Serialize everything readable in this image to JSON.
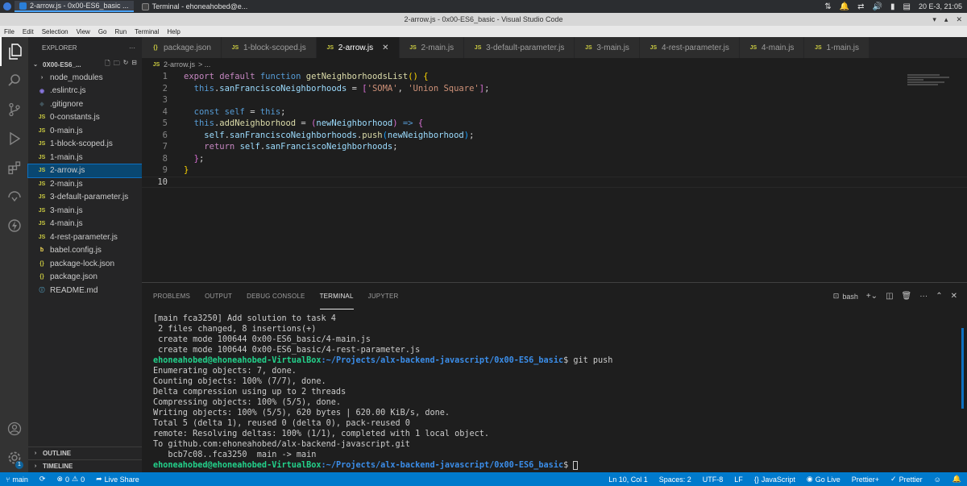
{
  "os": {
    "tasks": [
      {
        "label": "2-arrow.js - 0x00-ES6_basic ...",
        "active": true
      },
      {
        "label": "Terminal - ehoneahobed@e...",
        "active": false
      }
    ],
    "clock": "20 E-3, 21:05"
  },
  "window": {
    "title": "2-arrow.js - 0x00-ES6_basic - Visual Studio Code"
  },
  "menu": [
    "File",
    "Edit",
    "Selection",
    "View",
    "Go",
    "Run",
    "Terminal",
    "Help"
  ],
  "activity": {
    "accounts_badge": "1"
  },
  "sidebar": {
    "header": "EXPLORER",
    "more": "···",
    "folder": "0X00-ES6_...",
    "items": [
      {
        "label": "node_modules",
        "icon": "chevron-right-icon",
        "type": "folder"
      },
      {
        "label": ".eslintrc.js",
        "icon": "eslint-icon",
        "type": "eslint"
      },
      {
        "label": ".gitignore",
        "icon": "git-icon",
        "type": "git"
      },
      {
        "label": "0-constants.js",
        "icon": "js-icon",
        "type": "js"
      },
      {
        "label": "0-main.js",
        "icon": "js-icon",
        "type": "js"
      },
      {
        "label": "1-block-scoped.js",
        "icon": "js-icon",
        "type": "js"
      },
      {
        "label": "1-main.js",
        "icon": "js-icon",
        "type": "js"
      },
      {
        "label": "2-arrow.js",
        "icon": "js-icon",
        "type": "js",
        "selected": true
      },
      {
        "label": "2-main.js",
        "icon": "js-icon",
        "type": "js"
      },
      {
        "label": "3-default-parameter.js",
        "icon": "js-icon",
        "type": "js"
      },
      {
        "label": "3-main.js",
        "icon": "js-icon",
        "type": "js"
      },
      {
        "label": "4-main.js",
        "icon": "js-icon",
        "type": "js"
      },
      {
        "label": "4-rest-parameter.js",
        "icon": "js-icon",
        "type": "js"
      },
      {
        "label": "babel.config.js",
        "icon": "babel-icon",
        "type": "babel"
      },
      {
        "label": "package-lock.json",
        "icon": "json-icon",
        "type": "json"
      },
      {
        "label": "package.json",
        "icon": "json-icon",
        "type": "json"
      },
      {
        "label": "README.md",
        "icon": "info-icon",
        "type": "info"
      }
    ],
    "outline": "OUTLINE",
    "timeline": "TIMELINE"
  },
  "tabs": [
    {
      "label": "package.json",
      "icon": "{}",
      "type": "json"
    },
    {
      "label": "1-block-scoped.js",
      "icon": "JS",
      "type": "js"
    },
    {
      "label": "2-arrow.js",
      "icon": "JS",
      "type": "js",
      "active": true
    },
    {
      "label": "2-main.js",
      "icon": "JS",
      "type": "js"
    },
    {
      "label": "3-default-parameter.js",
      "icon": "JS",
      "type": "js"
    },
    {
      "label": "3-main.js",
      "icon": "JS",
      "type": "js"
    },
    {
      "label": "4-rest-parameter.js",
      "icon": "JS",
      "type": "js"
    },
    {
      "label": "4-main.js",
      "icon": "JS",
      "type": "js"
    },
    {
      "label": "1-main.js",
      "icon": "JS",
      "type": "js"
    }
  ],
  "breadcrumb": {
    "file_icon": "JS",
    "file": "2-arrow.js",
    "rest": "> ..."
  },
  "editor": {
    "current_line": 10,
    "lines": [
      [
        [
          "kw",
          "export"
        ],
        [
          "t",
          " "
        ],
        [
          "kw",
          "default"
        ],
        [
          "t",
          " "
        ],
        [
          "kwb",
          "function"
        ],
        [
          "t",
          " "
        ],
        [
          "fn",
          "getNeighborhoodsList"
        ],
        [
          "br1",
          "()"
        ],
        [
          "t",
          " "
        ],
        [
          "br1",
          "{"
        ]
      ],
      [
        [
          "t",
          "  "
        ],
        [
          "kwb",
          "this"
        ],
        [
          "t",
          "."
        ],
        [
          "var",
          "sanFranciscoNeighborhoods"
        ],
        [
          "t",
          " = "
        ],
        [
          "br2",
          "["
        ],
        [
          "str",
          "'SOMA'"
        ],
        [
          "t",
          ", "
        ],
        [
          "str",
          "'Union Square'"
        ],
        [
          "br2",
          "]"
        ],
        [
          "t",
          ";"
        ]
      ],
      [],
      [
        [
          "t",
          "  "
        ],
        [
          "kwb",
          "const"
        ],
        [
          "t",
          " "
        ],
        [
          "kwb",
          "self"
        ],
        [
          "t",
          " = "
        ],
        [
          "kwb",
          "this"
        ],
        [
          "t",
          ";"
        ]
      ],
      [
        [
          "t",
          "  "
        ],
        [
          "kwb",
          "this"
        ],
        [
          "t",
          "."
        ],
        [
          "fn",
          "addNeighborhood"
        ],
        [
          "t",
          " = "
        ],
        [
          "br2",
          "("
        ],
        [
          "var",
          "newNeighborhood"
        ],
        [
          "br2",
          ")"
        ],
        [
          "t",
          " "
        ],
        [
          "kwb",
          "=>"
        ],
        [
          "t",
          " "
        ],
        [
          "br2",
          "{"
        ]
      ],
      [
        [
          "t",
          "    "
        ],
        [
          "var",
          "self"
        ],
        [
          "t",
          "."
        ],
        [
          "var",
          "sanFranciscoNeighborhoods"
        ],
        [
          "t",
          "."
        ],
        [
          "fn",
          "push"
        ],
        [
          "br3",
          "("
        ],
        [
          "var",
          "newNeighborhood"
        ],
        [
          "br3",
          ")"
        ],
        [
          "t",
          ";"
        ]
      ],
      [
        [
          "t",
          "    "
        ],
        [
          "kw",
          "return"
        ],
        [
          "t",
          " "
        ],
        [
          "var",
          "self"
        ],
        [
          "t",
          "."
        ],
        [
          "var",
          "sanFranciscoNeighborhoods"
        ],
        [
          "t",
          ";"
        ]
      ],
      [
        [
          "t",
          "  "
        ],
        [
          "br2",
          "}"
        ],
        [
          "t",
          ";"
        ]
      ],
      [
        [
          "br1",
          "}"
        ]
      ],
      []
    ]
  },
  "panel": {
    "tabs": [
      "PROBLEMS",
      "OUTPUT",
      "DEBUG CONSOLE",
      "TERMINAL",
      "JUPYTER"
    ],
    "active_tab": "TERMINAL",
    "shell": "bash",
    "terminal_lines": [
      {
        "text": "[main fca3250] Add solution to task 4"
      },
      {
        "text": " 2 files changed, 8 insertions(+)"
      },
      {
        "text": " create mode 100644 0x00-ES6_basic/4-main.js"
      },
      {
        "text": " create mode 100644 0x00-ES6_basic/4-rest-parameter.js"
      },
      {
        "user": "ehoneahobed@ehoneahobed-VirtualBox",
        "path": ":~/Projects/alx-backend-javascript/0x00-ES6_basic",
        "cmd": "$ git push"
      },
      {
        "text": "Enumerating objects: 7, done."
      },
      {
        "text": "Counting objects: 100% (7/7), done."
      },
      {
        "text": "Delta compression using up to 2 threads"
      },
      {
        "text": "Compressing objects: 100% (5/5), done."
      },
      {
        "text": "Writing objects: 100% (5/5), 620 bytes | 620.00 KiB/s, done."
      },
      {
        "text": "Total 5 (delta 1), reused 0 (delta 0), pack-reused 0"
      },
      {
        "text": "remote: Resolving deltas: 100% (1/1), completed with 1 local object."
      },
      {
        "text": "To github.com:ehoneahobed/alx-backend-javascript.git"
      },
      {
        "text": "   bcb7c08..fca3250  main -> main"
      },
      {
        "user": "ehoneahobed@ehoneahobed-VirtualBox",
        "path": ":~/Projects/alx-backend-javascript/0x00-ES6_basic",
        "cmd": "$ ",
        "cursor": true
      }
    ]
  },
  "status": {
    "branch": "main",
    "errors": "0",
    "warnings": "0",
    "live_share": "Live Share",
    "position": "Ln 10, Col 1",
    "spaces": "Spaces: 2",
    "encoding": "UTF-8",
    "eol": "LF",
    "language": "JavaScript",
    "go_live": "Go Live",
    "prettier_plus": "Prettier+",
    "prettier": "Prettier"
  },
  "colors": {
    "accent": "#007acc",
    "selection": "#094771"
  }
}
